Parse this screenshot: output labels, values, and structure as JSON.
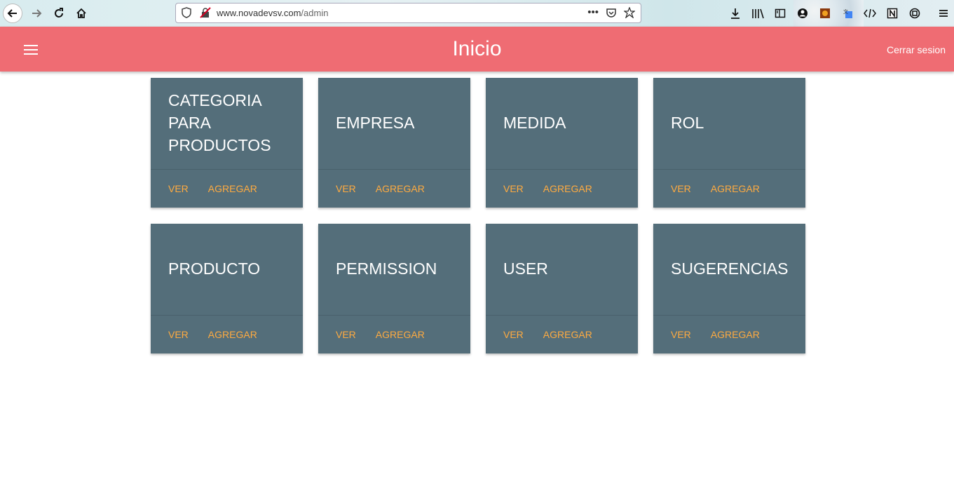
{
  "browser": {
    "url_domain": "www.novadevsv.com",
    "url_path": "/admin"
  },
  "header": {
    "title": "Inicio",
    "logout_label": "Cerrar sesion",
    "color": "#ef6c73"
  },
  "cards": [
    {
      "title": "CATEGORIA PARA PRODUCTOS",
      "view_label": "VER",
      "add_label": "AGREGAR"
    },
    {
      "title": "EMPRESA",
      "view_label": "VER",
      "add_label": "AGREGAR"
    },
    {
      "title": "MEDIDA",
      "view_label": "VER",
      "add_label": "AGREGAR"
    },
    {
      "title": "ROL",
      "view_label": "VER",
      "add_label": "AGREGAR"
    },
    {
      "title": "PRODUCTO",
      "view_label": "VER",
      "add_label": "AGREGAR"
    },
    {
      "title": "PERMISSION",
      "view_label": "VER",
      "add_label": "AGREGAR"
    },
    {
      "title": "USER",
      "view_label": "VER",
      "add_label": "AGREGAR"
    },
    {
      "title": "SUGERENCIAS",
      "view_label": "VER",
      "add_label": "AGREGAR"
    }
  ],
  "colors": {
    "card_bg": "#546e7a",
    "action": "#ffab40"
  }
}
